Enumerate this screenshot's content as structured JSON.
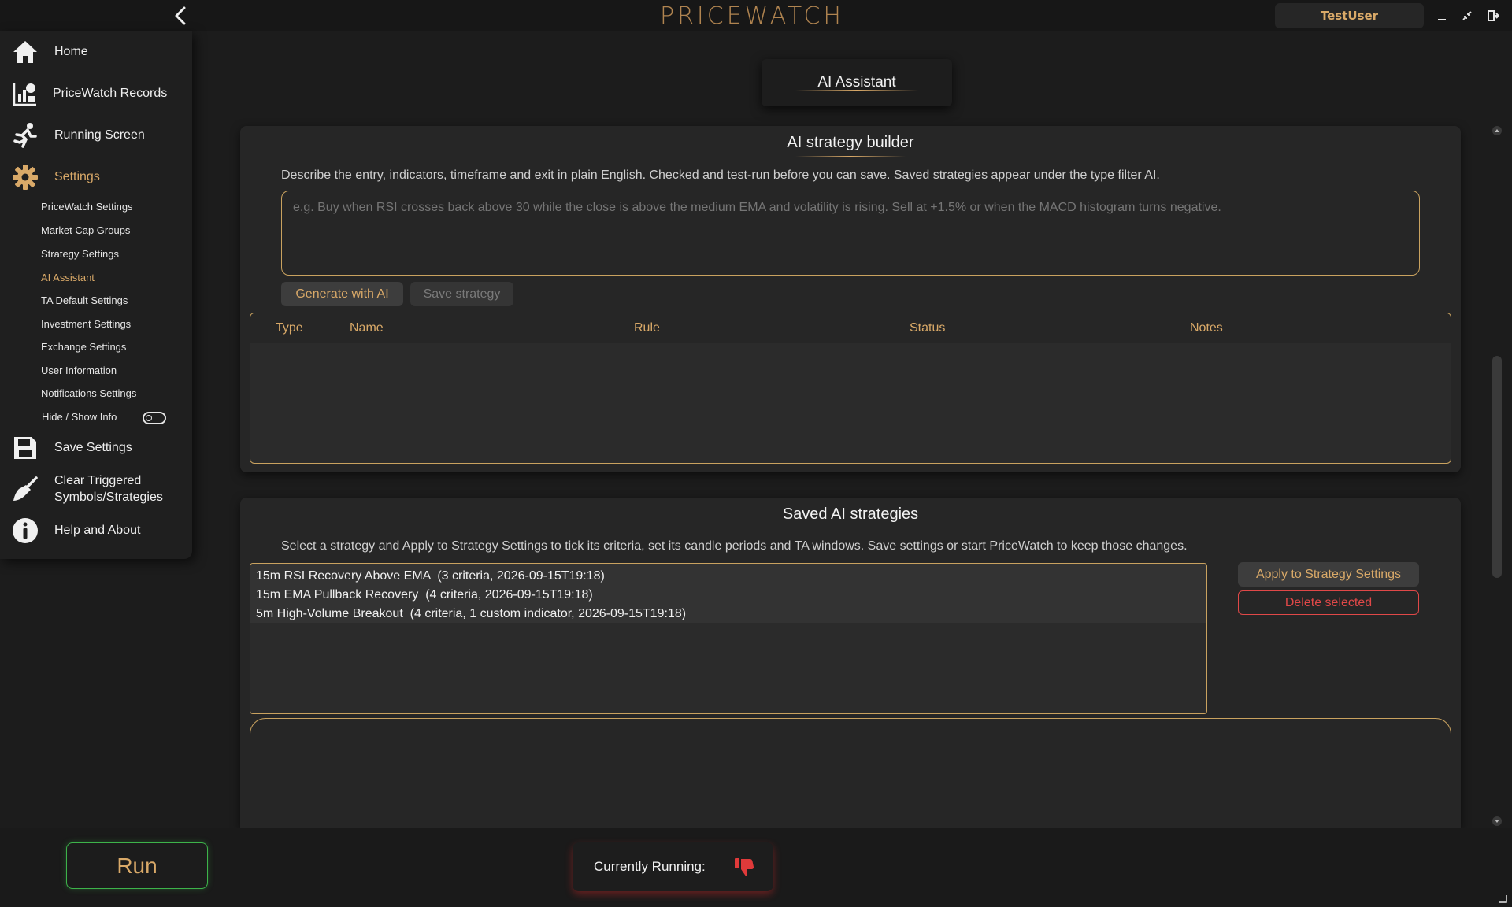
{
  "app": {
    "title": "PRICEWATCH",
    "user": "TestUser",
    "icons": {
      "back": "chevron-left-icon",
      "minimize": "minimize-icon",
      "restore": "restore-icon",
      "exit": "exit-icon"
    }
  },
  "sidebar": {
    "items": [
      {
        "label": "Home",
        "icon": "home-icon"
      },
      {
        "label": "PriceWatch Records",
        "icon": "records-icon"
      },
      {
        "label": "Running Screen",
        "icon": "running-icon"
      },
      {
        "label": "Settings",
        "icon": "gear-icon"
      },
      {
        "label": "Save Settings",
        "icon": "save-icon"
      },
      {
        "label_line1": "Clear Triggered",
        "label_line2": "Symbols/Strategies",
        "icon": "broom-icon"
      },
      {
        "label": "Help and About",
        "icon": "info-icon"
      }
    ],
    "settings_sub": [
      "PriceWatch Settings",
      "Market Cap Groups",
      "Strategy Settings",
      "AI Assistant",
      "TA Default Settings",
      "Investment Settings",
      "Exchange Settings",
      "User Information",
      "Notifications Settings",
      "Hide / Show Info"
    ],
    "active_sub": "AI Assistant"
  },
  "page": {
    "heading": "AI Assistant"
  },
  "builder": {
    "title": "AI strategy builder",
    "description": "Describe the entry, indicators, timeframe and exit in plain English. Checked and test-run before you can save. Saved strategies appear under the type filter AI.",
    "placeholder": "e.g. Buy when RSI crosses back above 30 while the close is above the medium EMA and volatility is rising. Sell at +1.5% or when the MACD histogram turns negative.",
    "generate_label": "Generate with AI",
    "save_label": "Save strategy",
    "columns": [
      "Type",
      "Name",
      "Rule",
      "Status",
      "Notes"
    ]
  },
  "saved": {
    "title": "Saved AI strategies",
    "description": "Select a strategy and Apply to Strategy Settings to tick its criteria, set its candle periods and TA windows. Save settings or start PriceWatch to keep those changes.",
    "strategies": [
      "15m RSI Recovery Above EMA  (3 criteria, 2026-09-15T19:18)",
      "15m EMA Pullback Recovery  (4 criteria, 2026-09-15T19:18)",
      "5m High-Volume Breakout  (4 criteria, 1 custom indicator, 2026-09-15T19:18)"
    ],
    "apply_label": "Apply to Strategy Settings",
    "delete_label": "Delete selected"
  },
  "bottom": {
    "run_label": "Run",
    "running_label": "Currently Running:",
    "running_icon": "thumbs-down-icon"
  },
  "colors": {
    "accent": "#d9a968",
    "danger": "#e04848",
    "run_border": "#3db34a"
  }
}
